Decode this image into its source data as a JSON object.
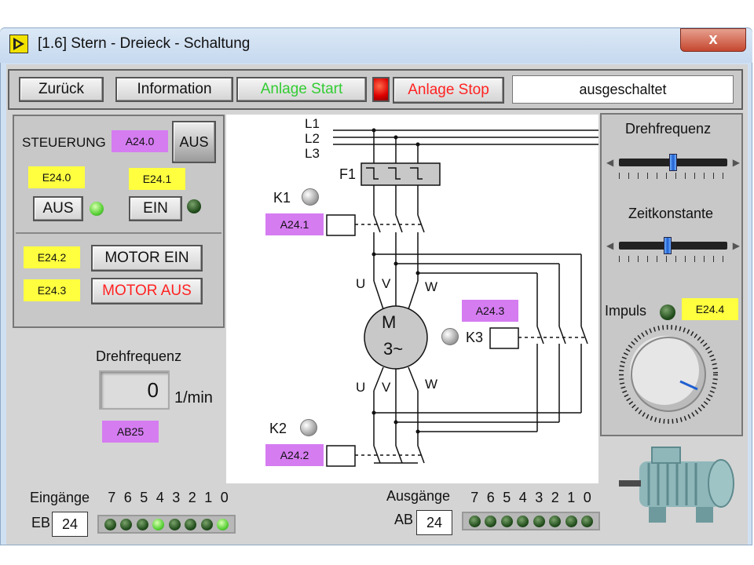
{
  "window": {
    "title": "[1.6] Stern - Dreieck - Schaltung",
    "close_symbol": "x"
  },
  "toolbar": {
    "back_label": "Zurück",
    "info_label": "Information",
    "start_label": "Anlage Start",
    "stop_label": "Anlage Stop",
    "status": "ausgeschaltet",
    "start_color": "#33cc33",
    "stop_color": "#ff2222",
    "indicator_color": "#dd0000"
  },
  "steuerung": {
    "label": "STEUERUNG",
    "output_tag": "A24.0",
    "aus_toggle": "AUS",
    "e240": "E24.0",
    "e241": "E24.1",
    "aus_button": "AUS",
    "ein_button": "EIN",
    "aus_led": "on",
    "ein_led": "off"
  },
  "motor_controls": {
    "e242": "E24.2",
    "e243": "E24.3",
    "motor_ein": "MOTOR EIN",
    "motor_aus": "MOTOR AUS"
  },
  "speed": {
    "label": "Drehfrequenz",
    "value": "0",
    "unit": "1/min",
    "tag": "AB25"
  },
  "diagram": {
    "l1": "L1",
    "l2": "L2",
    "l3": "L3",
    "f1": "F1",
    "k1": "K1",
    "k1_tag": "A24.1",
    "k2": "K2",
    "k2_tag": "A24.2",
    "k3": "K3",
    "k3_tag": "A24.3",
    "motor_m": "M",
    "motor_3": "3~",
    "u": "U",
    "v": "V",
    "w": "W"
  },
  "right_panel": {
    "drehfrequenz_label": "Drehfrequenz",
    "drehfrequenz_level": 0.5,
    "zeitkonstante_label": "Zeitkonstante",
    "zeitkonstante_level": 0.45,
    "impuls_label": "Impuls",
    "impuls_tag": "E24.4",
    "impuls_led": "off"
  },
  "io": {
    "inputs_label": "Eingänge",
    "outputs_label": "Ausgänge",
    "bits": [
      "7",
      "6",
      "5",
      "4",
      "3",
      "2",
      "1",
      "0"
    ],
    "eb_label": "EB",
    "eb_value": "24",
    "ab_label": "AB",
    "ab_value": "24",
    "input_leds": [
      "off",
      "off",
      "off",
      "on",
      "off",
      "off",
      "off",
      "on"
    ],
    "output_leds": [
      "off",
      "off",
      "off",
      "off",
      "off",
      "off",
      "off",
      "off"
    ]
  }
}
